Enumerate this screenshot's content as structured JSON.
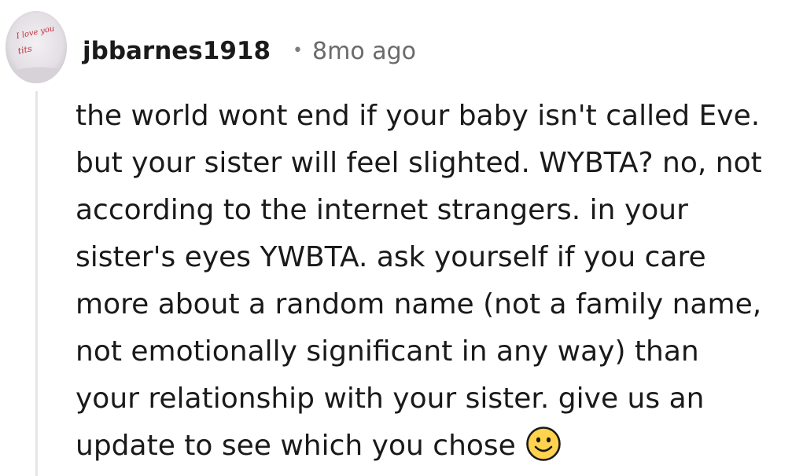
{
  "comment": {
    "author": "jbbarnes1918",
    "separator": "•",
    "age": "8mo ago",
    "avatar_text": [
      "I love you",
      "tits"
    ],
    "body_lines": [
      "the world wont end if your baby isn't called Eve.",
      "but your sister will feel slighted. WYBTA? no, not",
      "according to the internet strangers. in your",
      "sister's eyes YWBTA. ask yourself if you care",
      "more about a random name (not a family name,",
      "not emotionally significant in any way) than",
      "your relationship with your sister. give us an",
      "update to see which you chose"
    ],
    "end_emoji": "slightly-smiling-face-icon"
  },
  "colors": {
    "text": "#1a1a1b",
    "meta": "#6a6a6a",
    "thread_line": "#e4e6e8",
    "emoji_fill": "#ffd34d",
    "avatar_ink": "#c03040"
  }
}
